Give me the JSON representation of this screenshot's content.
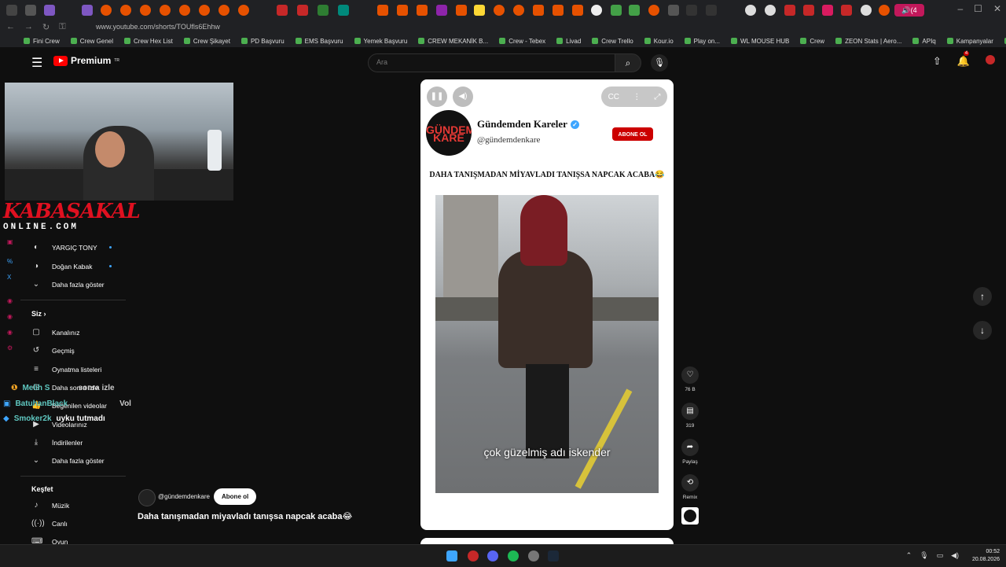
{
  "browser": {
    "url": "www.youtube.com/shorts/TOUfls6Ehhw",
    "tab_audio_label": "(4",
    "bookmarks": [
      "Fini Crew",
      "Crew Genel",
      "Crew Hex List",
      "Crew Şikayet",
      "PD Başvuru",
      "EMS Başvuru",
      "Yemek Başvuru",
      "CREW MEKANİK B...",
      "Crew - Tebex",
      "Livad",
      "Crew Trello",
      "Kour.io",
      "Play on...",
      "WL MOUSE HUB",
      "Crew",
      "ZEON Stats | Aero...",
      "APIq",
      "Kampanyalar",
      "Streamer Panel"
    ]
  },
  "header": {
    "logo_text": "Premium",
    "logo_sup": "TR",
    "search_placeholder": "Ara",
    "notification_count": "4"
  },
  "stream_overlay": {
    "brand_line1": "KABASAKAL",
    "brand_line2": "ONLINE.COM",
    "chat": [
      {
        "user": "Melih S",
        "message": "sonra izle"
      },
      {
        "user": "BatuhanBlack",
        "message": "Vol"
      },
      {
        "user": "Smoker2k",
        "message": "uyku tutmadı"
      }
    ]
  },
  "sidebar": {
    "subscriptions": [
      {
        "label": "YARGIÇ TONY",
        "icon": "avatar-icon"
      },
      {
        "label": "Doğan Kabak",
        "icon": "avatar-icon"
      }
    ],
    "show_more_1": "Daha fazla göster",
    "you_title": "Siz",
    "you_items": [
      {
        "label": "Kanalınız",
        "icon": "channel-icon"
      },
      {
        "label": "Geçmiş",
        "icon": "history-icon"
      },
      {
        "label": "Oynatma listeleri",
        "icon": "playlist-icon"
      },
      {
        "label": "Daha sonra izle",
        "icon": "clock-icon"
      },
      {
        "label": "Beğenilen videolar",
        "icon": "like-icon"
      },
      {
        "label": "Videolarınız",
        "icon": "video-icon"
      },
      {
        "label": "İndirilenler",
        "icon": "download-icon"
      }
    ],
    "show_more_2": "Daha fazla göster",
    "explore_title": "Keşfet",
    "explore_items": [
      {
        "label": "Müzik",
        "icon": "music-icon"
      },
      {
        "label": "Canlı",
        "icon": "live-icon"
      },
      {
        "label": "Oyun",
        "icon": "game-icon"
      }
    ]
  },
  "short": {
    "channel_name": "Gündemden Kareler",
    "channel_handle": "@gündemdenkare",
    "avatar_text": "GÜNDEMDEN KARE",
    "subscribe_label": "ABONE OL",
    "title_caption": "DAHA TANIŞMADAN MİYAVLADI TANIŞSA NAPCAK ACABA😂",
    "video_subtitle": "çok güzelmiş adı iskender"
  },
  "actions": {
    "like_count": "76 B",
    "comment_count": "319",
    "share_label": "Paylaş",
    "remix_label": "Remix"
  },
  "below": {
    "handle": "@gündemdenkare",
    "subscribe_label": "Abone ol",
    "title": "Daha tanışmadan miyavladı tanışsa napcak acaba😂"
  },
  "taskbar": {
    "time": "00:52",
    "date": "20.08.2026"
  },
  "colors": {
    "youtube_red": "#ff0000",
    "subscribe_red": "#cc0000",
    "verified_blue": "#3ea6ff",
    "brand_red": "#e01020"
  }
}
